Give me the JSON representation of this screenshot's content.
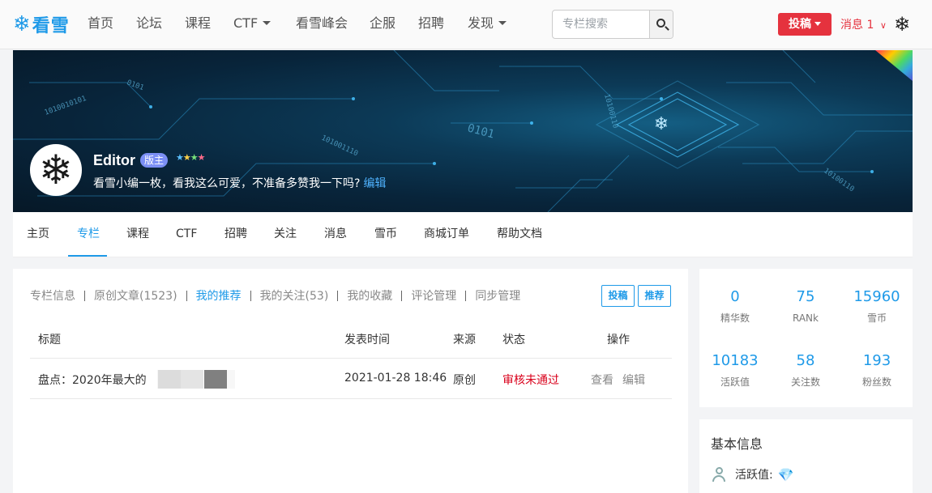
{
  "nav": {
    "logo_text": "看雪",
    "items": [
      {
        "label": "首页",
        "dropdown": false
      },
      {
        "label": "论坛",
        "dropdown": false
      },
      {
        "label": "课程",
        "dropdown": false
      },
      {
        "label": "CTF",
        "dropdown": true
      },
      {
        "label": "看雪峰会",
        "dropdown": false
      },
      {
        "label": "企服",
        "dropdown": false
      },
      {
        "label": "招聘",
        "dropdown": false
      },
      {
        "label": "发现",
        "dropdown": true
      }
    ],
    "search_placeholder": "专栏搜索",
    "post_label": "投稿",
    "messages_label": "消息",
    "messages_count": "1"
  },
  "profile": {
    "name": "Editor",
    "badge": "版主",
    "bio": "看雪小编一枚，看我这么可爱，不准备多赞我一下吗?",
    "edit_label": "编辑",
    "banner_codes": [
      "0101",
      "1010010101",
      "101001110",
      "0101",
      "10100110",
      "10100110"
    ]
  },
  "tabs": [
    "主页",
    "专栏",
    "课程",
    "CTF",
    "招聘",
    "关注",
    "消息",
    "雪币",
    "商城订单",
    "帮助文档"
  ],
  "active_tab": "专栏",
  "subnav": {
    "items": [
      "专栏信息",
      "原创文章(1523)",
      "我的推荐",
      "我的关注(53)",
      "我的收藏",
      "评论管理",
      "同步管理"
    ],
    "active": "我的推荐",
    "btn_post": "投稿",
    "btn_recommend": "推荐"
  },
  "table": {
    "headers": {
      "title": "标题",
      "time": "发表时间",
      "source": "来源",
      "status": "状态",
      "ops": "操作"
    },
    "rows": [
      {
        "title": "盘点：2020年最大的",
        "time": "2021-01-28 18:46",
        "source": "原创",
        "status": "审核未通过",
        "op_view": "查看",
        "op_edit": "编辑"
      }
    ]
  },
  "stats": [
    {
      "value": "0",
      "label": "精华数"
    },
    {
      "value": "75",
      "label": "RANk"
    },
    {
      "value": "15960",
      "label": "雪币"
    },
    {
      "value": "10183",
      "label": "活跃值"
    },
    {
      "value": "58",
      "label": "关注数"
    },
    {
      "value": "193",
      "label": "粉丝数"
    }
  ],
  "basic_info": {
    "title": "基本信息",
    "activity_label": "活跃值:"
  },
  "colors": {
    "accent": "#1f9ae8",
    "danger": "#e5323e",
    "status_fail": "#d9001b",
    "badge": "#7b8ff5"
  }
}
